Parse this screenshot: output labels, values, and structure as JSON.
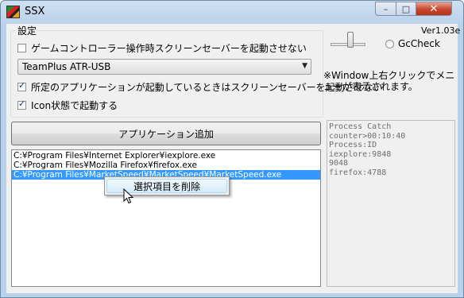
{
  "window": {
    "title": "SSX",
    "controls": {
      "minimize": "–",
      "maximize": "□",
      "close": "✕"
    }
  },
  "settings_group": {
    "label": "設定",
    "checkboxes": [
      {
        "label": "ゲームコントローラー操作時スクリーンセーバーを起動させない",
        "checked": false
      },
      {
        "label": "所定のアプリケーションが起動しているときはスクリーンセーバーを起動させない",
        "checked": true
      },
      {
        "label": "Icon状態で起動する",
        "checked": true
      }
    ],
    "device_combo": {
      "value": "TeamPlus ATR-USB"
    }
  },
  "right_panel": {
    "version": "Ver1.03e",
    "gc_check_label": "GcCheck",
    "note": "※Window上右クリックでメニューが表示されます。"
  },
  "add_app_button": {
    "label": "アプリケーション追加"
  },
  "app_list": {
    "items": [
      {
        "path": "C:¥Program Files¥Internet Explorer¥iexplore.exe",
        "selected": false
      },
      {
        "path": "C:¥Program Files¥Mozilla Firefox¥firefox.exe",
        "selected": false
      },
      {
        "path": "C:¥Program Files¥MarketSpeed¥MarketSpeed¥MarketSpeed.exe",
        "selected": true
      }
    ]
  },
  "process_info": {
    "lines": [
      "Process Catch",
      "counter>00:10:40",
      "Process:ID",
      "iexplore:9848",
      "9048",
      "firefox:4788"
    ]
  },
  "context_menu": {
    "items": [
      {
        "label": "選択項目を削除"
      }
    ]
  },
  "colors": {
    "selection": "#3399ff",
    "window_frame": "#b9d1ea",
    "close_button": "#c7462e"
  }
}
